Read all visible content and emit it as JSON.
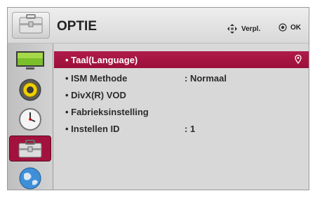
{
  "header": {
    "title": "OPTIE",
    "back_label": "Verpl.",
    "ok_label": "OK"
  },
  "sidebar": {
    "items": [
      {
        "icon": "picture-icon"
      },
      {
        "icon": "audio-icon"
      },
      {
        "icon": "clock-icon"
      },
      {
        "icon": "option-toolbox-icon",
        "active": true
      },
      {
        "icon": "network-globe-icon"
      }
    ]
  },
  "menu": {
    "items": [
      {
        "label": "• Taal(Language)",
        "value": ""
      },
      {
        "label": "• ISM Methode",
        "value": ": Normaal"
      },
      {
        "label": "• DivX(R) VOD",
        "value": ""
      },
      {
        "label": "• Fabrieksinstelling",
        "value": ""
      },
      {
        "label": "• Instellen ID",
        "value": ": 1"
      }
    ]
  },
  "colors": {
    "selection": "#a3123f",
    "background": "#d6d6d6"
  }
}
